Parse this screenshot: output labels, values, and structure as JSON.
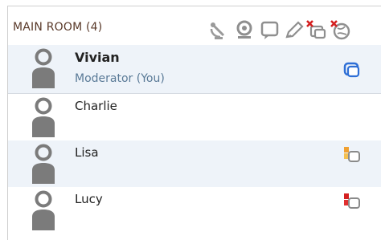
{
  "room": {
    "title": "MAIN ROOM (4)"
  },
  "toolbar": {
    "icons": [
      "satellite-dish-icon",
      "webcam-icon",
      "chat-bubble-icon",
      "pencil-icon",
      "stop-chat-icon",
      "stop-share-icon"
    ]
  },
  "participants": [
    {
      "name": "Vivian",
      "role": "Moderator (You)",
      "bold": true,
      "status_icon": "chat-bubble-blue-icon"
    },
    {
      "name": "Charlie",
      "role": "",
      "bold": false,
      "status_icon": ""
    },
    {
      "name": "Lisa",
      "role": "",
      "bold": false,
      "status_icon": "chat-bubble-orange-icon"
    },
    {
      "name": "Lucy",
      "role": "",
      "bold": false,
      "status_icon": "chat-bubble-red-icon"
    }
  ],
  "colors": {
    "title_text": "#5a3a2a",
    "role_text": "#5a7a97",
    "row_shade": "#eef3f9",
    "status_blue": "#2f6fd6",
    "status_orange": "#f0a030",
    "status_red": "#d42020",
    "avatar_gray": "#7b7b7b"
  }
}
